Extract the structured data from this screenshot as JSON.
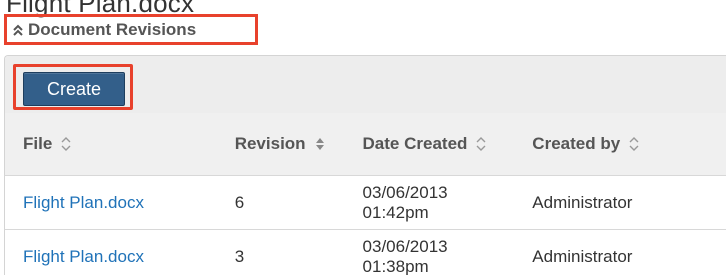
{
  "page_heading_cropped": "Flight Plan.docx",
  "subpanel": {
    "title": "Document Revisions",
    "collapse_icon": "double-chevron-up-icon"
  },
  "toolbar": {
    "create_label": "Create"
  },
  "table": {
    "columns": [
      {
        "label": "File",
        "sort_icon": "sort-both-icon"
      },
      {
        "label": "Revision",
        "sort_icon": "sort-both-icon"
      },
      {
        "label": "Date Created",
        "sort_icon": "sort-both-icon"
      },
      {
        "label": "Created by",
        "sort_icon": "sort-both-icon"
      }
    ],
    "rows": [
      {
        "file": "Flight Plan.docx",
        "revision": "6",
        "date": "03/06/2013",
        "time": "01:42pm",
        "created_by": "Administrator"
      },
      {
        "file": "Flight Plan.docx",
        "revision": "3",
        "date": "03/06/2013",
        "time": "01:38pm",
        "created_by": "Administrator"
      }
    ]
  },
  "colors": {
    "highlight": "#e8412c",
    "button": "#335f8a",
    "link": "#1f72b8"
  }
}
